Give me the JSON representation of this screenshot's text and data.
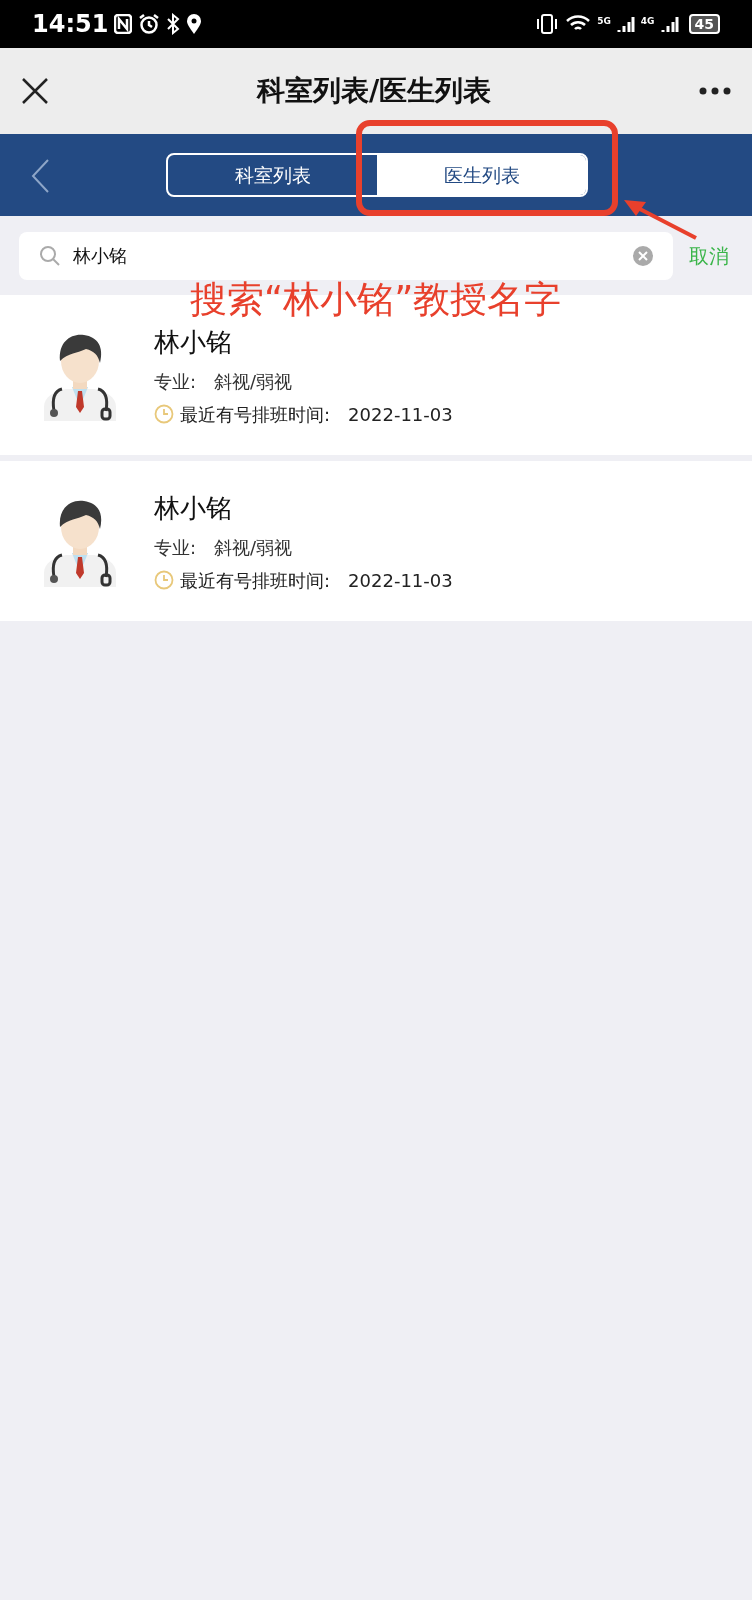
{
  "status_bar": {
    "time": "14:51",
    "network_1": "5G",
    "network_2": "4G",
    "battery": "45"
  },
  "header": {
    "title": "科室列表/医生列表"
  },
  "tabs": [
    {
      "label": "科室列表",
      "selected": false
    },
    {
      "label": "医生列表",
      "selected": true
    }
  ],
  "search": {
    "value": "林小铭",
    "cancel": "取消"
  },
  "annotation": {
    "text": "搜索“林小铭”教授名字"
  },
  "doctors": [
    {
      "name": "林小铭",
      "specialty_label": "专业:",
      "specialty": "斜视/弱视",
      "schedule_label": "最近有号排班时间:",
      "schedule_date": "2022-11-03"
    },
    {
      "name": "林小铭",
      "specialty_label": "专业:",
      "specialty": "斜视/弱视",
      "schedule_label": "最近有号排班时间:",
      "schedule_date": "2022-11-03"
    }
  ]
}
